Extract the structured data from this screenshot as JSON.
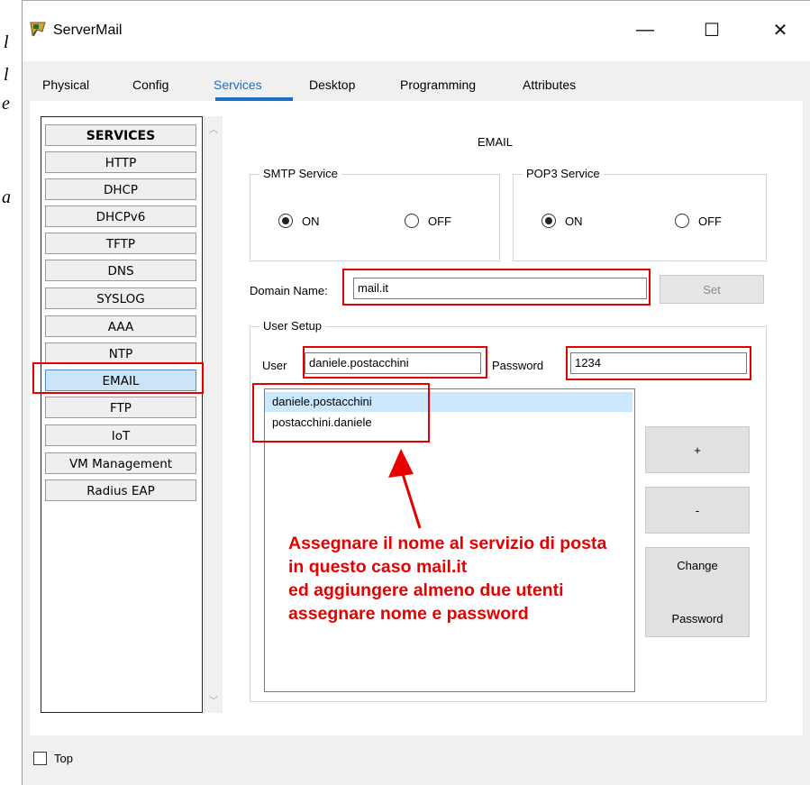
{
  "background_doc": {
    "glyphs": [
      "l",
      "l",
      "e",
      "a"
    ]
  },
  "window": {
    "title": "ServerMail",
    "app_icon": "packet-tracer-server-icon",
    "controls": {
      "minimize": "—",
      "maximize": "☐",
      "close": "✕"
    }
  },
  "tabs": [
    {
      "label": "Physical"
    },
    {
      "label": "Config"
    },
    {
      "label": "Services",
      "active": true
    },
    {
      "label": "Desktop"
    },
    {
      "label": "Programming"
    },
    {
      "label": "Attributes"
    }
  ],
  "services": {
    "header": "SERVICES",
    "items": [
      "HTTP",
      "DHCP",
      "DHCPv6",
      "TFTP",
      "DNS",
      "SYSLOG",
      "AAA",
      "NTP",
      "EMAIL",
      "FTP",
      "IoT",
      "VM Management",
      "Radius EAP"
    ],
    "selected": "EMAIL"
  },
  "email": {
    "title": "EMAIL",
    "smtp": {
      "label": "SMTP Service",
      "on_label": "ON",
      "off_label": "OFF",
      "value": "ON"
    },
    "pop3": {
      "label": "POP3 Service",
      "on_label": "ON",
      "off_label": "OFF",
      "value": "ON"
    },
    "domain": {
      "label": "Domain Name:",
      "value": "mail.it",
      "set_label": "Set"
    },
    "user_setup": {
      "label": "User Setup",
      "user_label": "User",
      "user_value": "daniele.postacchini",
      "password_label": "Password",
      "password_value": "1234",
      "users": [
        "daniele.postacchini",
        "postacchini.daniele"
      ],
      "selected_user": "daniele.postacchini",
      "add_label": "+",
      "remove_label": "-",
      "change_password_line1": "Change",
      "change_password_line2": "Password"
    }
  },
  "annotation": {
    "lines": [
      "Assegnare il nome al servizio di posta",
      "in questo caso mail.it",
      "ed aggiungere almeno due utenti",
      "assegnare nome e password"
    ],
    "color": "#e60000"
  },
  "footer": {
    "top_label": "Top",
    "top_checked": false
  }
}
